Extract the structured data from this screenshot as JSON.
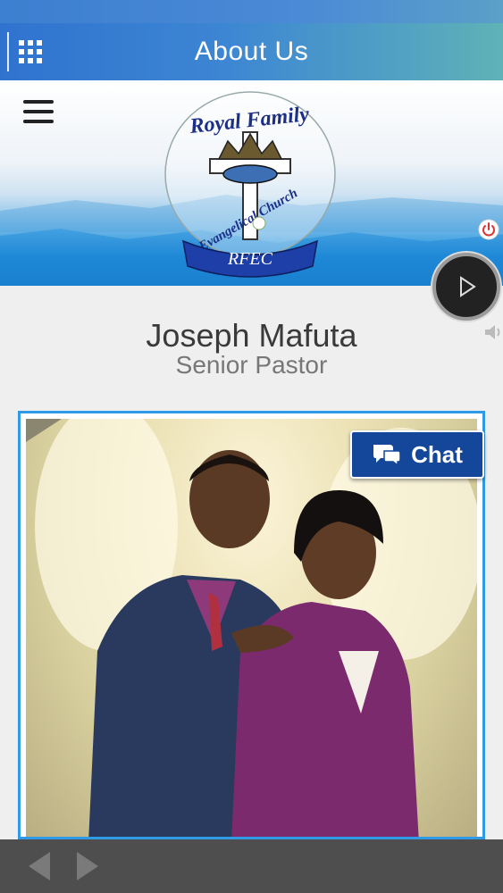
{
  "header": {
    "title": "About Us"
  },
  "logo": {
    "line1": "Royal Family",
    "line2": "Evangelical Church",
    "abbr": "RFEC"
  },
  "pastor": {
    "name": "Joseph Mafuta",
    "role": "Senior Pastor"
  },
  "chat": {
    "label": "Chat"
  },
  "colors": {
    "accent": "#2f73cf",
    "chat": "#14479a",
    "frame": "#2f9ae6",
    "bottom_bar": "#4e4e4e"
  },
  "icons": [
    "apps-grid-icon",
    "hamburger-menu-icon",
    "power-icon",
    "play-icon",
    "volume-icon",
    "chat-bubbles-icon",
    "arrow-left-icon",
    "arrow-right-icon"
  ]
}
